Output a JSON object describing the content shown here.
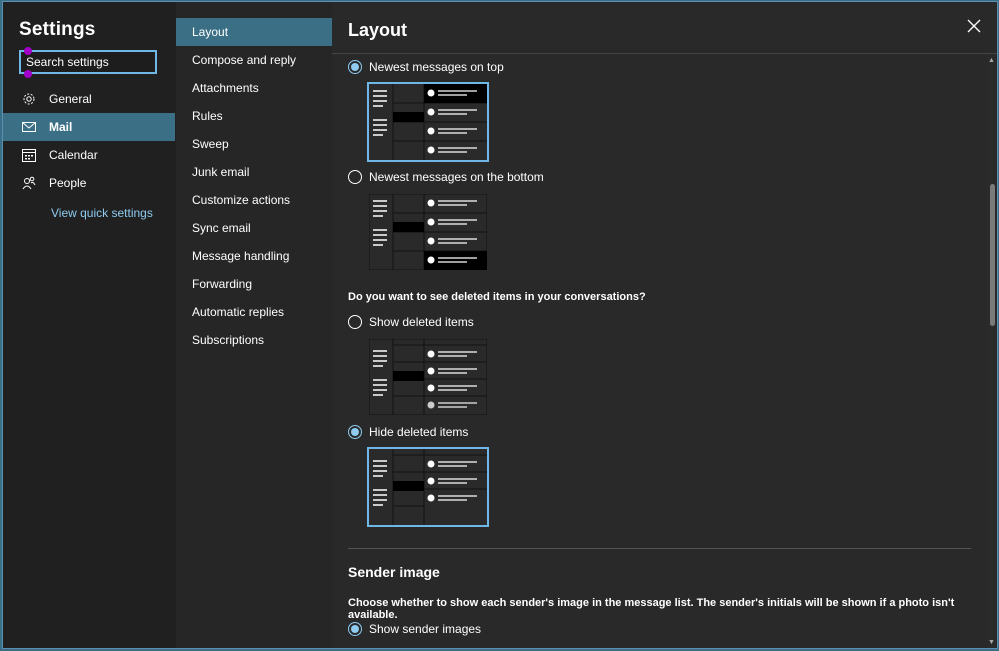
{
  "settings": {
    "title": "Settings",
    "search_placeholder": "Search settings",
    "nav": [
      {
        "label": "General",
        "icon": "gear-icon"
      },
      {
        "label": "Mail",
        "icon": "mail-icon",
        "active": true
      },
      {
        "label": "Calendar",
        "icon": "calendar-icon"
      },
      {
        "label": "People",
        "icon": "people-icon"
      }
    ],
    "quick_settings": "View quick settings"
  },
  "mail_nav": [
    {
      "label": "Layout",
      "active": true
    },
    {
      "label": "Compose and reply"
    },
    {
      "label": "Attachments"
    },
    {
      "label": "Rules"
    },
    {
      "label": "Sweep"
    },
    {
      "label": "Junk email"
    },
    {
      "label": "Customize actions"
    },
    {
      "label": "Sync email"
    },
    {
      "label": "Message handling"
    },
    {
      "label": "Forwarding"
    },
    {
      "label": "Automatic replies"
    },
    {
      "label": "Subscriptions"
    }
  ],
  "page": {
    "title": "Layout",
    "close_icon": "close-icon",
    "order_options": [
      {
        "label": "Newest messages on top",
        "selected": true
      },
      {
        "label": "Newest messages on the bottom",
        "selected": false
      }
    ],
    "deleted_question": "Do you want to see deleted items in your conversations?",
    "deleted_options": [
      {
        "label": "Show deleted items",
        "selected": false
      },
      {
        "label": "Hide deleted items",
        "selected": true
      }
    ],
    "sender_image": {
      "title": "Sender image",
      "description": "Choose whether to show each sender's image in the message list. The sender's initials will be shown if a photo isn't available.",
      "option": {
        "label": "Show sender images",
        "selected": true
      }
    }
  },
  "colors": {
    "accent": "#8ecbf0",
    "active_nav": "#3b6f85",
    "background": "#292929"
  }
}
